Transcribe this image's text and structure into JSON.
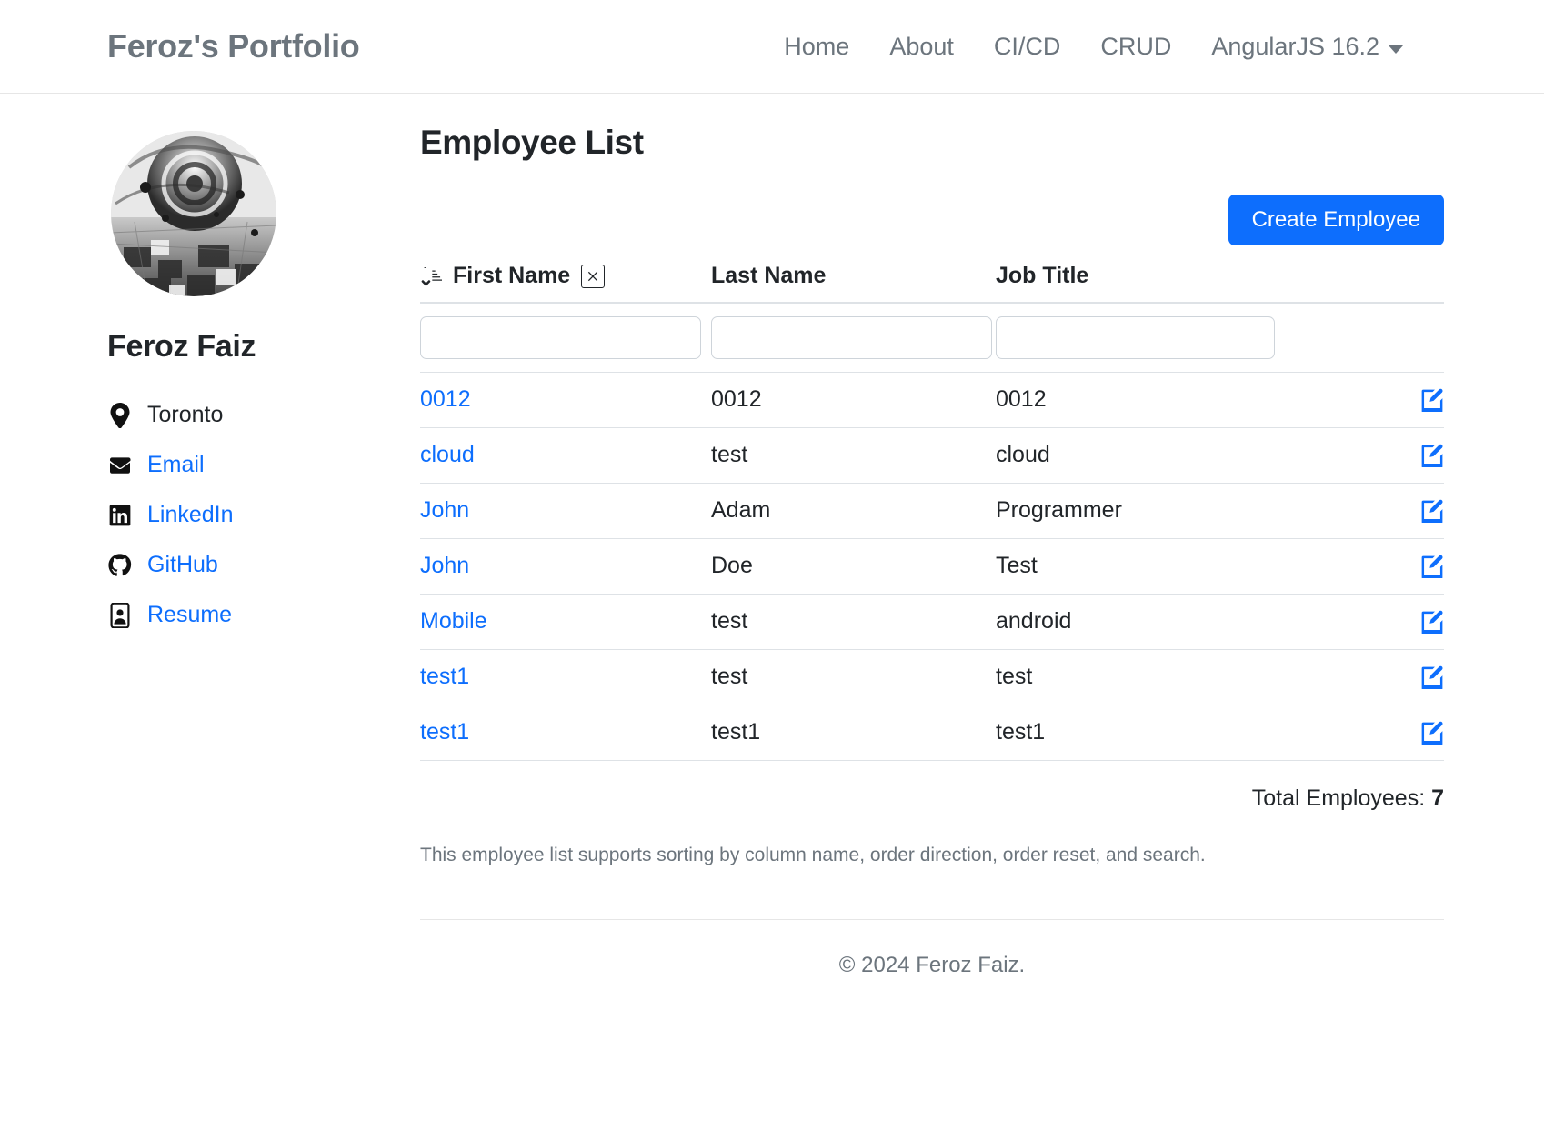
{
  "navbar": {
    "brand": "Feroz's Portfolio",
    "links": [
      {
        "label": "Home"
      },
      {
        "label": "About"
      },
      {
        "label": "CI/CD"
      },
      {
        "label": "CRUD"
      }
    ],
    "dropdown": {
      "label": "AngularJS 16.2"
    }
  },
  "sidebar": {
    "name": "Feroz Faiz",
    "items": [
      {
        "label": "Toronto",
        "icon": "location-pin-icon",
        "link": false
      },
      {
        "label": "Email",
        "icon": "envelope-icon",
        "link": true
      },
      {
        "label": "LinkedIn",
        "icon": "linkedin-icon",
        "link": true
      },
      {
        "label": "GitHub",
        "icon": "github-icon",
        "link": true
      },
      {
        "label": "Resume",
        "icon": "id-card-icon",
        "link": true
      }
    ]
  },
  "main": {
    "title": "Employee List",
    "create_button": "Create Employee",
    "columns": [
      {
        "label": "First Name"
      },
      {
        "label": "Last Name"
      },
      {
        "label": "Job Title"
      }
    ],
    "sort": {
      "column": "First Name",
      "direction": "ascending",
      "clear_label": "✕"
    },
    "filters": {
      "first_name": "",
      "last_name": "",
      "job_title": "",
      "placeholder": ""
    },
    "rows": [
      {
        "first_name": "0012",
        "last_name": "0012",
        "job_title": "0012"
      },
      {
        "first_name": "cloud",
        "last_name": "test",
        "job_title": "cloud"
      },
      {
        "first_name": "John",
        "last_name": "Adam",
        "job_title": "Programmer"
      },
      {
        "first_name": "John",
        "last_name": "Doe",
        "job_title": "Test"
      },
      {
        "first_name": "Mobile",
        "last_name": "test",
        "job_title": "android"
      },
      {
        "first_name": "test1",
        "last_name": "test",
        "job_title": "test"
      },
      {
        "first_name": "test1",
        "last_name": "test1",
        "job_title": "test1"
      }
    ],
    "total_label": "Total Employees:",
    "total_value": "7",
    "note": "This employee list supports sorting by column name, order direction, order reset, and search."
  },
  "footer": {
    "text": "© 2024 Feroz Faiz."
  },
  "colors": {
    "accent": "#0d6efd",
    "muted": "#6c757d",
    "border": "#dee2e6",
    "text": "#212529"
  }
}
